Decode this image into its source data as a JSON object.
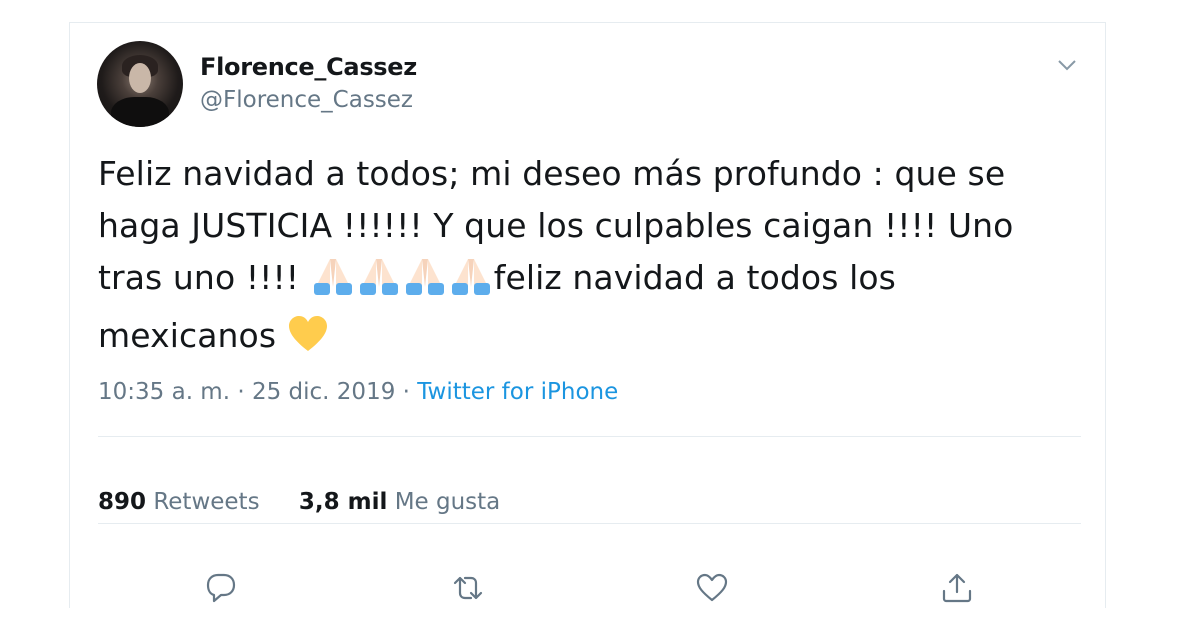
{
  "author": {
    "display_name": "Florence_Cassez",
    "handle": "@Florence_Cassez"
  },
  "tweet": {
    "text_line1": "Feliz navidad a todos; mi deseo más profundo : que se",
    "text_line2": "haga JUSTICIA !!!!!! Y que los culpables caigan !!!! Uno",
    "text_line3_a": "tras uno !!!! ",
    "text_line3_b": "feliz navidad a todos los",
    "text_line4": "mexicanos ",
    "time": "10:35 a. m.",
    "separator": " · ",
    "date": "25 dic. 2019",
    "source": "Twitter for iPhone"
  },
  "stats": {
    "retweets_count": "890",
    "retweets_label": "Retweets",
    "likes_count": "3,8 mil",
    "likes_label": "Me gusta"
  },
  "icons": {
    "caret": "chevron-down-icon",
    "reply": "reply-icon",
    "retweet": "retweet-icon",
    "like": "heart-icon",
    "share": "share-icon",
    "praying_hands": "praying-hands-emoji",
    "heart_emoji": "yellow-heart-emoji"
  },
  "colors": {
    "text": "#14171a",
    "secondary": "#657786",
    "link": "#1b95e0",
    "border": "#e6ecf0",
    "emoji_heart": "#ffcc4d",
    "emoji_hands": "#fde3cf",
    "emoji_sleeve": "#5dadec"
  }
}
